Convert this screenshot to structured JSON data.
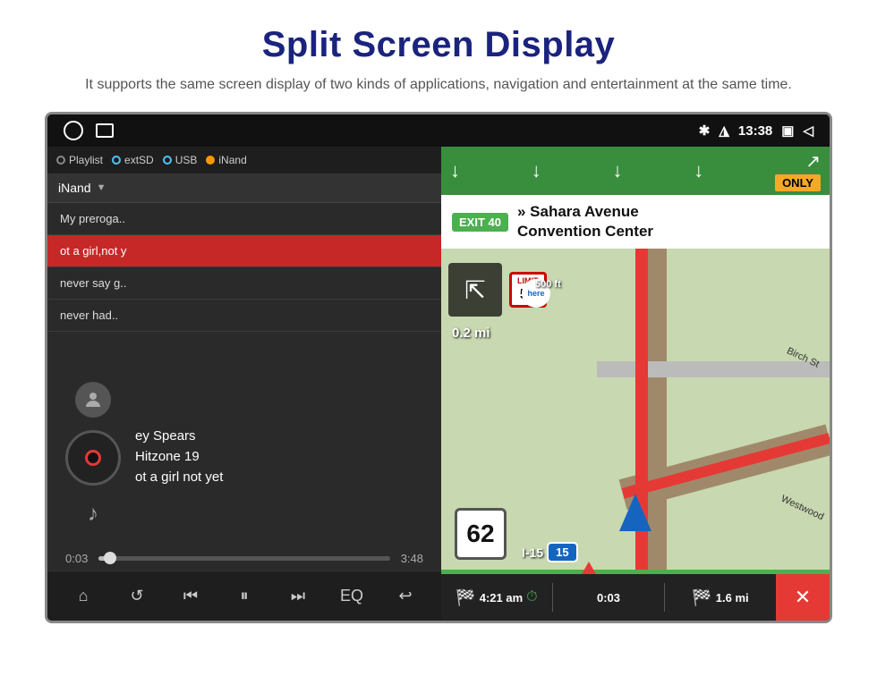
{
  "header": {
    "title": "Split Screen Display",
    "subtitle": "It supports the same screen display of two kinds of applications,\nnavigation and entertainment at the same time."
  },
  "status_bar": {
    "time": "13:38",
    "icons": [
      "bluetooth",
      "location",
      "window",
      "back"
    ]
  },
  "music": {
    "source_tabs": [
      "Playlist",
      "extSD",
      "USB",
      "iNand"
    ],
    "selector_label": "iNand",
    "playlist": [
      {
        "title": "My preroga..",
        "active": false
      },
      {
        "title": "ot a girl,not y",
        "active": true
      },
      {
        "title": "never say g..",
        "active": false
      },
      {
        "title": "never had..",
        "active": false
      }
    ],
    "artist": "ey Spears",
    "album": "Hitzone 19",
    "track": "ot a girl not yet",
    "time_current": "0:03",
    "time_total": "3:48",
    "progress_percent": 2
  },
  "navigation": {
    "exit_number": "EXIT 40",
    "destination_line1": "» Sahara Avenue",
    "destination_line2": "Convention Center",
    "only_label": "ONLY",
    "distance_label": "0.2 mi",
    "speed": "62",
    "highway_label": "I-15",
    "highway_badge": "15",
    "eta_time": "4:21 am",
    "eta_duration": "0:03",
    "eta_distance": "1.6 mi",
    "road_labels": [
      "Birch St",
      "Westwood"
    ]
  },
  "controls": {
    "home": "⌂",
    "repeat": "↺",
    "prev": "⏮",
    "play_pause": "⏸",
    "next": "⏭",
    "eq": "EQ",
    "back": "↩"
  }
}
